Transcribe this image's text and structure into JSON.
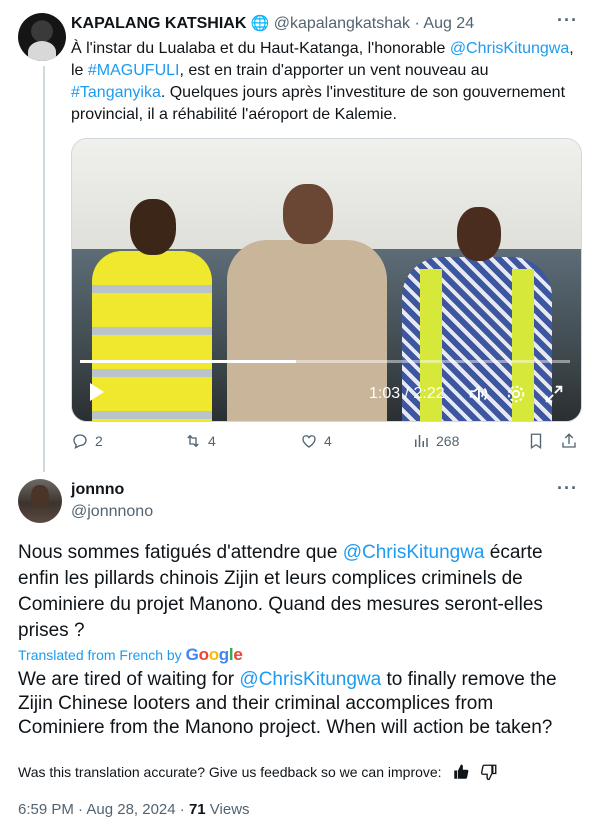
{
  "quoted": {
    "name": "KAPALANG KATSHIAK",
    "handle": "@kapalangkatshak",
    "date": "Aug 24",
    "text_parts": [
      "À l'instar du Lualaba et du Haut-Katanga, l'honorable ",
      "@ChrisKitungwa",
      ", le ",
      "#MAGUFULI",
      ", est en train d'apporter un vent nouveau au ",
      "#Tanganyika",
      ". Quelques jours après l'investiture de son gouvernement provincial, il a réhabilité l'aéroport de Kalemie."
    ],
    "video": {
      "time": "1:03 / 2:22",
      "progress": 0.44
    },
    "actions": {
      "replies": "2",
      "retweets": "4",
      "likes": "4",
      "views": "268"
    }
  },
  "tweet": {
    "name": "jonnno",
    "handle": "@jonnnono",
    "text_parts": [
      "Nous sommes fatigués d'attendre que ",
      "@ChrisKitungwa",
      " écarte enfin les pillards chinois Zijin et leurs complices criminels de Cominiere du projet Manono. Quand des mesures seront-elles prises ?"
    ],
    "translated_label": "Translated from French by",
    "google": "Google",
    "translation_parts": [
      "We are tired of waiting for ",
      "@ChrisKitungwa",
      " to finally remove the Zijin Chinese looters and their criminal accomplices from Cominiere from the Manono project. When will action be taken?"
    ],
    "feedback": "Was this translation accurate? Give us feedback so we can improve:",
    "timestamp": "6:59 PM · Aug 28, 2024 · ",
    "views_count": "71",
    "views_label": " Views"
  },
  "colors": {
    "link": "#1d9bf0",
    "muted": "#536471",
    "text": "#0f1419"
  }
}
